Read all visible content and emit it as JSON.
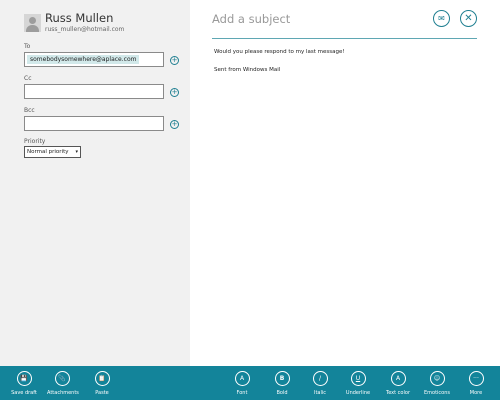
{
  "sender": {
    "name": "Russ Mullen",
    "email": "russ_mullen@hotmail.com"
  },
  "fields": {
    "to": {
      "label": "To",
      "value": "somebodysomewhere@aplace.com"
    },
    "cc": {
      "label": "Cc",
      "value": ""
    },
    "bcc": {
      "label": "Bcc",
      "value": ""
    },
    "priority": {
      "label": "Priority",
      "value": "Normal priority"
    }
  },
  "message": {
    "subject_placeholder": "Add a subject",
    "body_line1": "Would you please respond to my last message!",
    "body_line2": "Sent from Windows Mail"
  },
  "icons": {
    "plus": "+",
    "chevron": "▾",
    "send": "✉",
    "close": "✕",
    "save_draft": "💾",
    "attachments": "📎",
    "paste": "📋",
    "font": "A",
    "bold": "B",
    "italic": "/",
    "underline": "U",
    "text_color": "A",
    "emoticons": "☺",
    "more": "···"
  },
  "appbar": {
    "save_draft": "Save draft",
    "attachments": "Attachments",
    "paste": "Paste",
    "font": "Font",
    "bold": "Bold",
    "italic": "Italic",
    "underline": "Underline",
    "text_color": "Text color",
    "emoticons": "Emoticons",
    "more": "More"
  },
  "colors": {
    "accent": "#13849a",
    "pane": "#f1f1f1"
  }
}
